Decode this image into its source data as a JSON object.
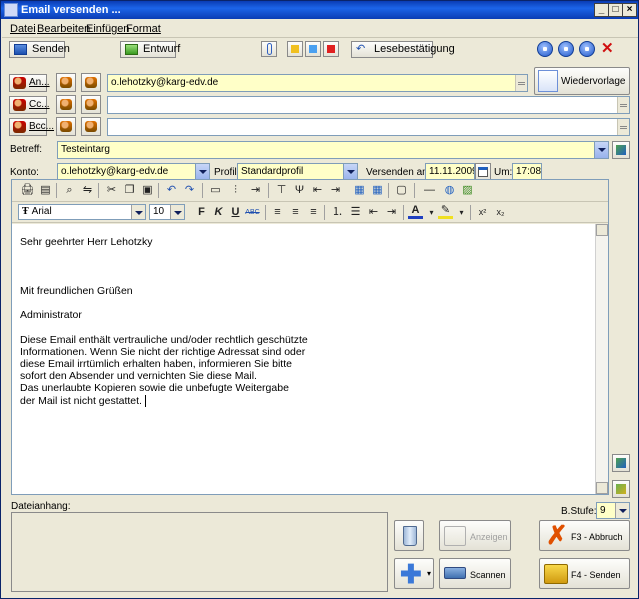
{
  "window": {
    "title": "Email versenden ..."
  },
  "menu": [
    "Datei",
    "Bearbeiten",
    "Einfügen",
    "Format"
  ],
  "toolbar": {
    "send_label": "Senden",
    "draft_label": "Entwurf",
    "read_receipt_label": "Lesebestätigung",
    "template_label": "Wiedervorlage"
  },
  "recipients": {
    "to_label": "An...",
    "cc_label": "Cc...",
    "bcc_label": "Bcc...",
    "to_value": "o.lehotzky@karg-edv.de",
    "cc_value": "",
    "bcc_value": ""
  },
  "subject": {
    "label": "Betreff:",
    "value": "Testeintarg"
  },
  "account": {
    "label": "Konto:",
    "value": "o.lehotzky@karg-edv.de",
    "profile_label": "Profil:",
    "profile_value": "Standardprofil",
    "send_at_label": "Versenden am:",
    "date": "11.11.2009",
    "time_label": "Um:",
    "time": "17:08"
  },
  "format": {
    "font": "Arial",
    "size": "10"
  },
  "body": {
    "lines": [
      "Sehr geehrter Herr Lehotzky",
      "",
      "",
      "",
      "Mit freundlichen Grüßen",
      "",
      "Administrator",
      "",
      "Diese Email enthält vertrauliche und/oder rechtlich geschützte",
      "Informationen. Wenn Sie nicht der richtige Adressat sind oder",
      "diese Email irrtümlich erhalten haben, informieren Sie bitte",
      "sofort den Absender und vernichten Sie diese Mail.",
      "Das unerlaubte Kopieren sowie die unbefugte Weitergabe",
      "der Mail ist nicht gestattet."
    ]
  },
  "attachment": {
    "label": "Dateianhang:",
    "level_label": "B.Stufe:",
    "level_value": "9"
  },
  "actions": {
    "show_label": "Anzeigen",
    "scan_label": "Scannen",
    "cancel_label": "F3 - Abbruch",
    "send_label": "F4 - Senden"
  },
  "colors": {
    "title_bar": "#0a3cb4",
    "highlight_field": "#ffffc8",
    "cancel_x": "#e05000",
    "window_bg": "#ece9d8"
  }
}
